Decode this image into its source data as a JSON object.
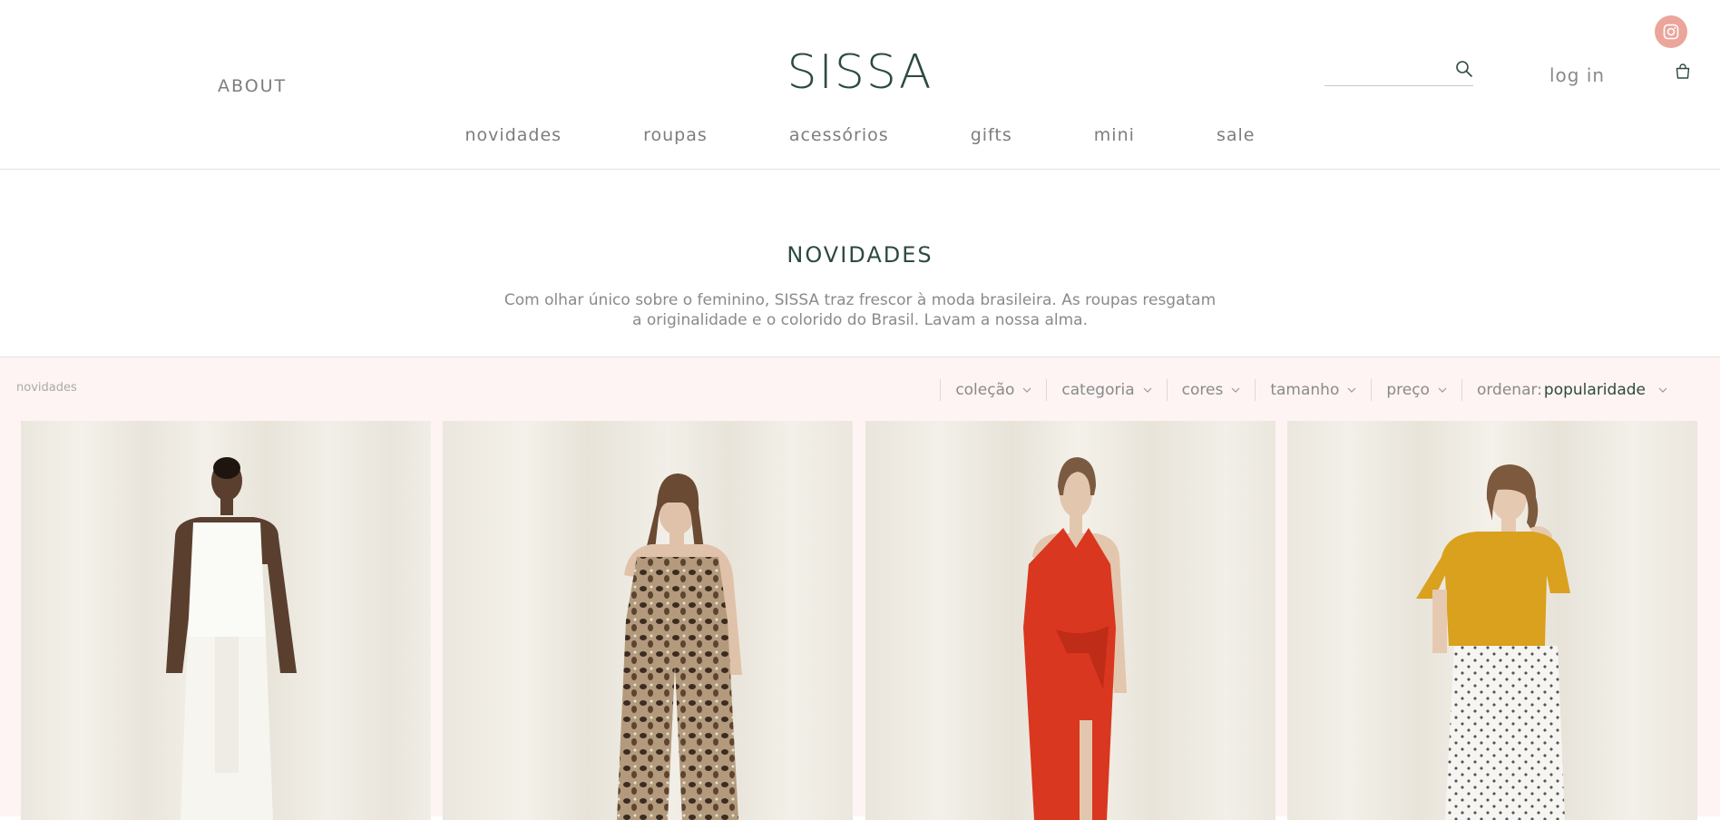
{
  "header": {
    "about_label": "ABOUT",
    "logo": "SISSA",
    "search": {
      "placeholder": "",
      "value": ""
    },
    "login_label": "log in",
    "icons": {
      "search": "search-icon",
      "bag": "bag-icon",
      "instagram": "instagram-icon"
    },
    "nav": [
      {
        "label": "novidades"
      },
      {
        "label": "roupas"
      },
      {
        "label": "acessórios"
      },
      {
        "label": "gifts"
      },
      {
        "label": "mini"
      },
      {
        "label": "sale"
      }
    ]
  },
  "intro": {
    "title": "NOVIDADES",
    "description": "Com olhar único sobre o feminino, SISSA traz frescor à moda brasileira. As roupas resgatam a originalidade e o colorido do Brasil. Lavam a nossa alma."
  },
  "catalog": {
    "breadcrumb": "novidades",
    "filters": [
      {
        "label": "coleção"
      },
      {
        "label": "categoria"
      },
      {
        "label": "cores"
      },
      {
        "label": "tamanho"
      },
      {
        "label": "preço"
      }
    ],
    "sort": {
      "label": "ordenar:",
      "value": "popularidade"
    },
    "products": [
      {
        "image": "model-white-scalloped-top-and-skirt"
      },
      {
        "image": "model-animal-print-jumpsuit"
      },
      {
        "image": "model-red-halter-wrap-dress"
      },
      {
        "image": "model-mustard-tee-printed-pants"
      }
    ]
  },
  "colors": {
    "brand_green": "#2d4a3e",
    "text_gray": "#8a8a8a",
    "catalog_bg": "#fdf4f3",
    "instagram_badge": "#eba59a"
  }
}
